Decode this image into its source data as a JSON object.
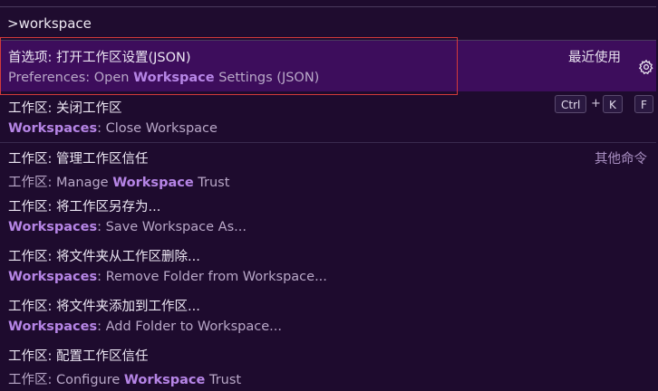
{
  "input": {
    "value": ">workspace",
    "placeholder": ""
  },
  "items": [
    {
      "line1": "首选项: 打开工作区设置(JSON)",
      "line2": {
        "pre": "Preferences: Open ",
        "hl": "Workspace",
        "post": " Settings (JSON)"
      },
      "group": "最近使用"
    },
    {
      "line1": "工作区: 关闭工作区",
      "line2": {
        "pre": "",
        "hl": "Workspaces",
        "post": ": Close Workspace"
      },
      "keys": [
        "Ctrl",
        "K",
        "F"
      ]
    },
    {
      "line1": "工作区: 管理工作区信任",
      "line2": {
        "pre": "工作区: Manage ",
        "hl": "Workspace",
        "post": " Trust"
      },
      "group": "其他命令"
    },
    {
      "line1": "工作区: 将工作区另存为...",
      "line2": {
        "pre": "",
        "hl": "Workspaces",
        "post": ": Save Workspace As..."
      }
    },
    {
      "line1": "工作区: 将文件夹从工作区删除...",
      "line2": {
        "pre": "",
        "hl": "Workspaces",
        "post": ": Remove Folder from Workspace..."
      }
    },
    {
      "line1": "工作区: 将文件夹添加到工作区...",
      "line2": {
        "pre": "",
        "hl": "Workspaces",
        "post": ": Add Folder to Workspace..."
      }
    },
    {
      "line1": "工作区: 配置工作区信任",
      "line2": {
        "pre": "工作区: Configure ",
        "hl": "Workspace",
        "post": " Trust"
      }
    }
  ],
  "key_plus": "+",
  "colors": {
    "selected_bg": "#3d0d5c",
    "highlight": "#b685e6",
    "focus_border": "#d23a3a"
  },
  "icons": {
    "gear": "gear-icon"
  }
}
